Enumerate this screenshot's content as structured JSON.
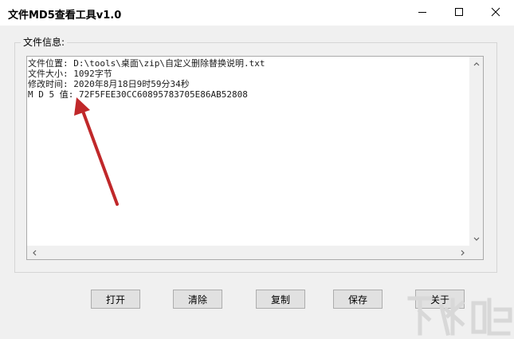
{
  "window": {
    "title": "文件MD5查看工具v1.0",
    "controls": [
      "minimize-icon",
      "maximize-icon",
      "close-icon"
    ]
  },
  "group": {
    "label": "文件信息:"
  },
  "info": {
    "lines": [
      "文件位置: D:\\tools\\桌面\\zip\\自定义删除替换说明.txt",
      "文件大小: 1092字节",
      "修改时间: 2020年8月18日9时59分34秒",
      "M D 5 值: 72F5FEE30CC60895783705E86AB52808"
    ]
  },
  "buttons": {
    "open": "打开",
    "clear": "清除",
    "copy": "复制",
    "save": "保存",
    "about": "关于"
  },
  "annotation": {
    "arrow_color": "#c0282a"
  },
  "watermark": {
    "text": "下载吧"
  }
}
